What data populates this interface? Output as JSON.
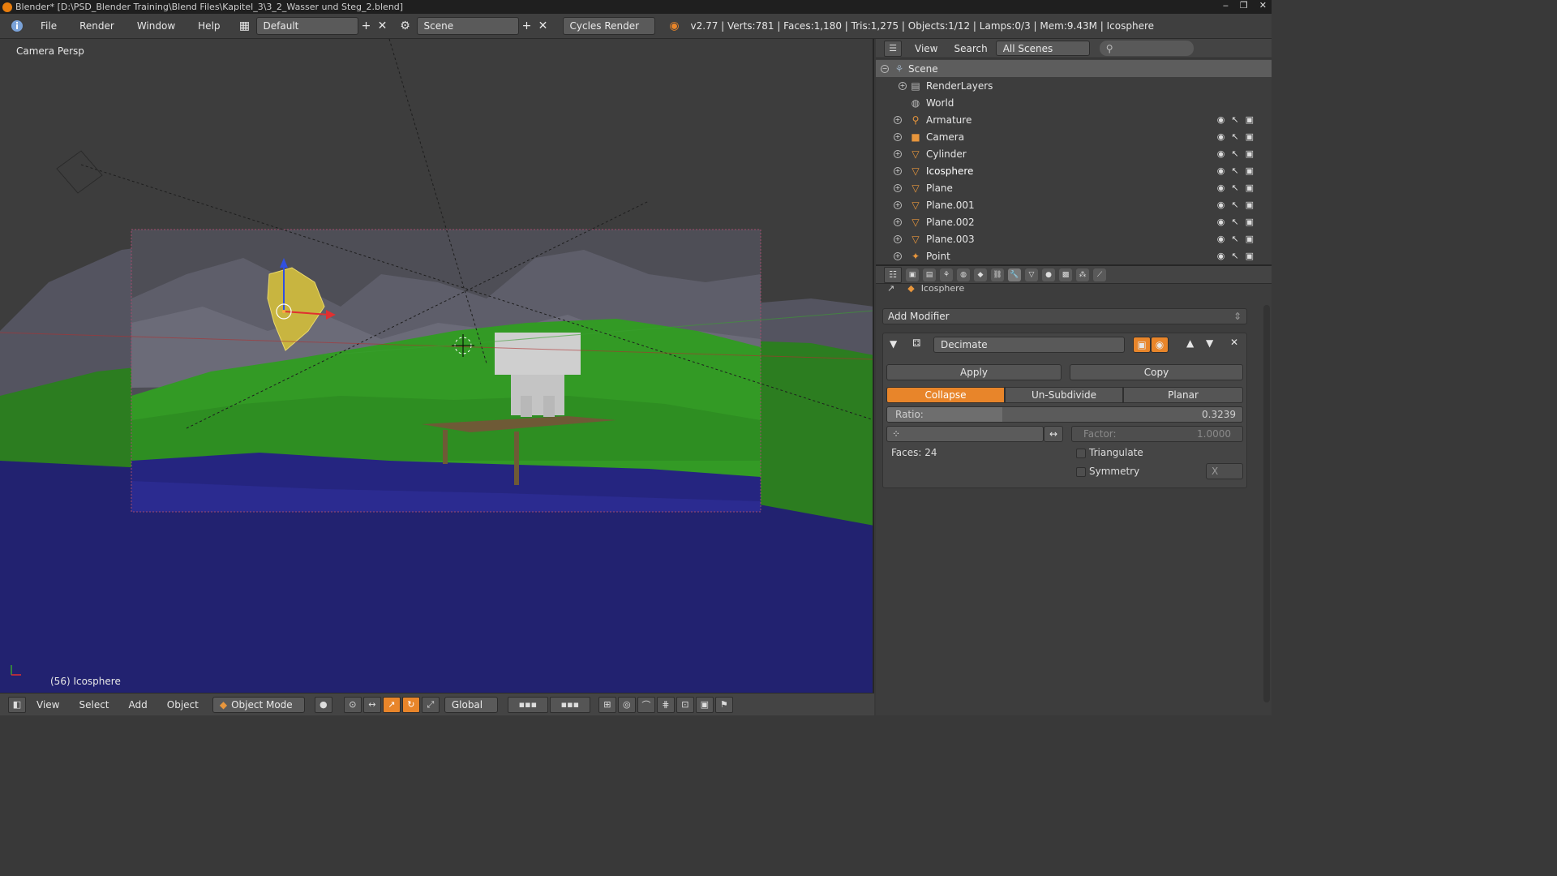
{
  "titlebar": {
    "title": "Blender* [D:\\PSD_Blender Training\\Blend Files\\Kapitel_3\\3_2_Wasser und Steg_2.blend]",
    "minimize": "‒",
    "maximize": "❐",
    "close": "✕"
  },
  "infobar": {
    "menus": [
      "File",
      "Render",
      "Window",
      "Help"
    ],
    "layout": "Default",
    "scene": "Scene",
    "engine": "Cycles Render",
    "stats": "v2.77 | Verts:781 | Faces:1,180 | Tris:1,275 | Objects:1/12 | Lamps:0/3 | Mem:9.43M | Icosphere"
  },
  "viewport": {
    "view_label": "Camera Persp",
    "object_label": "(56) Icosphere",
    "colors": {
      "sky": "#3d3d3d",
      "mountains": "#5a5a66",
      "grass": "#2f8a22",
      "water": "#232277",
      "selected": "#c8b540"
    }
  },
  "viewport_header": {
    "menus": [
      "View",
      "Select",
      "Add",
      "Object"
    ],
    "mode": "Object Mode",
    "orientation": "Global"
  },
  "outliner": {
    "menus": [
      "View",
      "Search"
    ],
    "filter": "All Scenes",
    "rows": [
      {
        "name": "Scene",
        "icon": "scene-icon",
        "selected": true
      },
      {
        "name": "RenderLayers",
        "icon": "render-layers-icon"
      },
      {
        "name": "World",
        "icon": "world-icon"
      },
      {
        "name": "Armature",
        "icon": "armature-icon"
      },
      {
        "name": "Camera",
        "icon": "camera-icon"
      },
      {
        "name": "Cylinder",
        "icon": "mesh-icon"
      },
      {
        "name": "Icosphere",
        "icon": "mesh-icon"
      },
      {
        "name": "Plane",
        "icon": "mesh-icon"
      },
      {
        "name": "Plane.001",
        "icon": "mesh-icon"
      },
      {
        "name": "Plane.002",
        "icon": "mesh-icon"
      },
      {
        "name": "Plane.003",
        "icon": "mesh-icon"
      },
      {
        "name": "Point",
        "icon": "lamp-icon"
      }
    ]
  },
  "properties": {
    "breadcrumb": "Icosphere",
    "add_modifier": "Add Modifier",
    "modifier": {
      "name": "Decimate",
      "apply": "Apply",
      "copy": "Copy",
      "modes": [
        "Collapse",
        "Un-Subdivide",
        "Planar"
      ],
      "active_mode": "Collapse",
      "ratio_label": "Ratio:",
      "ratio": "0.3239",
      "ratio_fraction": 0.3239,
      "factor_label": "Factor:",
      "factor": "1.0000",
      "faces": "Faces: 24",
      "triangulate": "Triangulate",
      "symmetry": "Symmetry",
      "symmetry_axis": "X"
    }
  }
}
